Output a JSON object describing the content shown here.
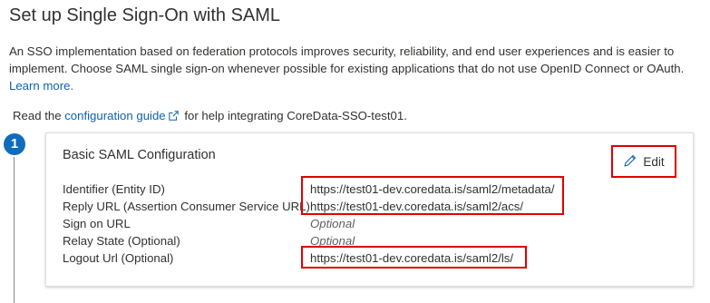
{
  "page": {
    "title": "Set up Single Sign-On with SAML",
    "intro_text": "An SSO implementation based on federation protocols improves security, reliability, and end user experiences and is easier to implement. Choose SAML single sign-on whenever possible for existing applications that do not use OpenID Connect or OAuth.",
    "learn_more_link": "Learn more.",
    "guide_prefix": "Read the",
    "guide_link": "configuration guide",
    "guide_suffix": "for help integrating CoreData-SSO-test01."
  },
  "step": {
    "number": "1",
    "card_title": "Basic SAML Configuration",
    "edit_label": "Edit",
    "rows": [
      {
        "label": "Identifier (Entity ID)",
        "value": "https://test01-dev.coredata.is/saml2/metadata/",
        "optional": false
      },
      {
        "label": "Reply URL (Assertion Consumer Service URL)",
        "value": "https://test01-dev.coredata.is/saml2/acs/",
        "optional": false
      },
      {
        "label": "Sign on URL",
        "value": "Optional",
        "optional": true
      },
      {
        "label": "Relay State (Optional)",
        "value": "Optional",
        "optional": true
      },
      {
        "label": "Logout Url (Optional)",
        "value": "https://test01-dev.coredata.is/saml2/ls/",
        "optional": false
      }
    ]
  },
  "icons": {
    "external_link": "external-link-icon",
    "edit": "pencil-icon"
  },
  "colors": {
    "link": "#0f62ad",
    "step_badge": "#0f6cbd",
    "highlight": "#e00000"
  }
}
